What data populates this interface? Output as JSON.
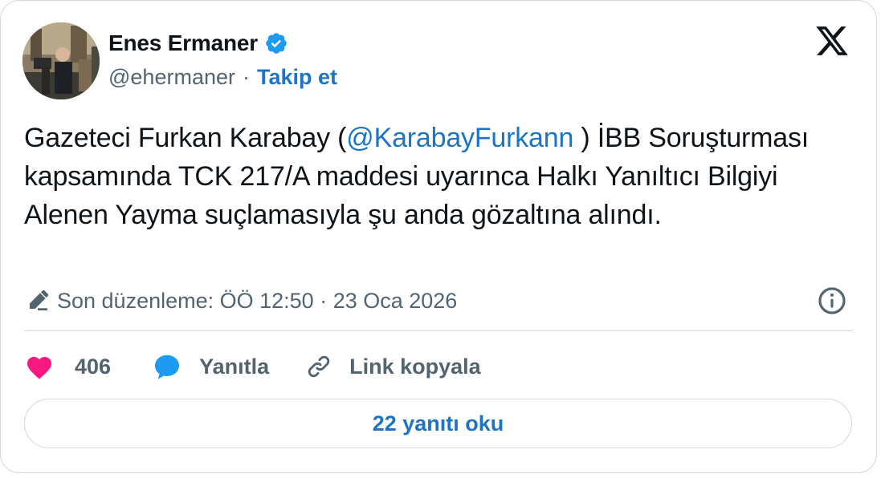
{
  "author": {
    "display_name": "Enes Ermaner",
    "handle": "@ehermaner",
    "separator": "·",
    "follow_label": "Takip et",
    "verified": true
  },
  "tweet": {
    "text_before": "Gazeteci Furkan Karabay (",
    "mention": "@KarabayFurkann",
    "text_after": " ) İBB Soruşturması kapsamında TCK 217/A maddesi uyarınca Halkı Yanıltıcı Bilgiyi Alenen Yayma suçlamasıyla şu anda gözaltına alındı."
  },
  "edit_info": {
    "label": "Son düzenleme: ÖÖ 12:50 · 23 Oca 2026"
  },
  "actions": {
    "like_count": "406",
    "reply_label": "Yanıtla",
    "copy_link_label": "Link kopyala"
  },
  "read_replies_label": "22 yanıtı oku",
  "icons": {
    "brand": "x-logo-icon",
    "verified": "verified-badge-icon",
    "edit": "pencil-icon",
    "info": "info-icon",
    "like": "heart-icon",
    "reply": "speech-bubble-icon",
    "copy": "link-icon"
  },
  "colors": {
    "accent_blue": "#1d74c5",
    "verified_blue": "#1d9bf0",
    "heart_pink": "#f91880",
    "text_primary": "#0f1419",
    "text_secondary": "#536471",
    "border": "#cfd9de"
  }
}
